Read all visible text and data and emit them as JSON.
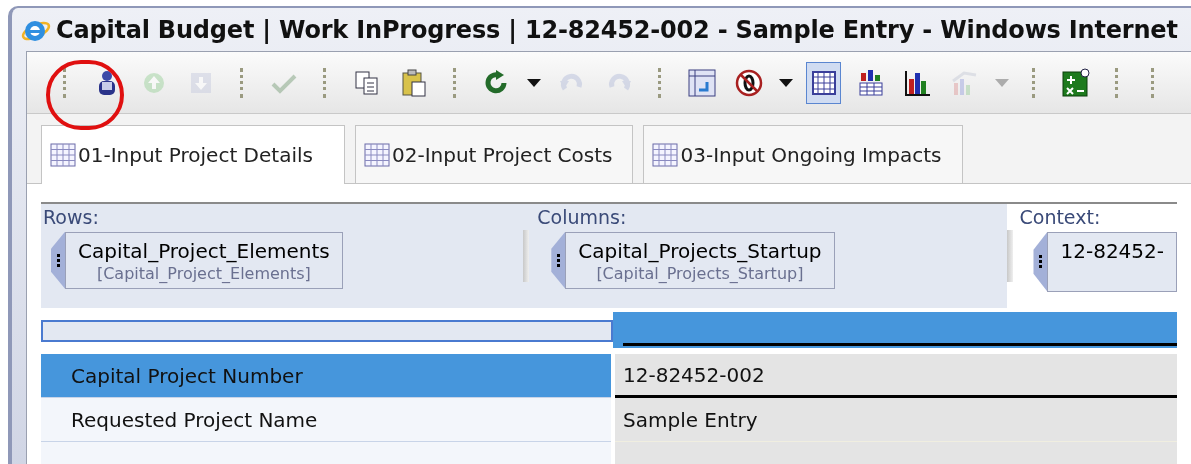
{
  "window": {
    "title": "Capital Budget | Work InProgress | 12-82452-002 - Sample Entry - Windows Internet"
  },
  "toolbar": [
    {
      "kind": "separator"
    },
    {
      "kind": "button",
      "disabled": false,
      "selected": false
    },
    {
      "kind": "button",
      "disabled": true,
      "selected": false
    },
    {
      "kind": "button",
      "disabled": true,
      "selected": false
    },
    {
      "kind": "separator"
    },
    {
      "kind": "button",
      "disabled": true,
      "selected": false
    },
    {
      "kind": "separator"
    },
    {
      "kind": "button",
      "disabled": false,
      "selected": false
    },
    {
      "kind": "button",
      "disabled": false,
      "selected": false
    },
    {
      "kind": "separator"
    },
    {
      "kind": "button",
      "disabled": false,
      "selected": false
    },
    {
      "kind": "caret",
      "disabled": false
    },
    {
      "kind": "button",
      "disabled": true,
      "selected": false
    },
    {
      "kind": "button",
      "disabled": true,
      "selected": false
    },
    {
      "kind": "separator"
    },
    {
      "kind": "button",
      "disabled": false,
      "selected": false
    },
    {
      "kind": "button",
      "disabled": false,
      "selected": false
    },
    {
      "kind": "caret",
      "disabled": false
    },
    {
      "kind": "button",
      "disabled": false,
      "selected": true
    },
    {
      "kind": "button",
      "disabled": false,
      "selected": false
    },
    {
      "kind": "button",
      "disabled": false,
      "selected": false
    },
    {
      "kind": "button",
      "disabled": true,
      "selected": false
    },
    {
      "kind": "caret",
      "disabled": true
    },
    {
      "kind": "separator"
    },
    {
      "kind": "button",
      "disabled": false,
      "selected": false
    },
    {
      "kind": "separator"
    },
    {
      "kind": "separator"
    }
  ],
  "tabs": [
    {
      "label": "01-Input Project Details",
      "selected": true
    },
    {
      "label": "02-Input Project Costs",
      "selected": false
    },
    {
      "label": "03-Input Ongoing Impacts",
      "selected": false
    }
  ],
  "pivot": {
    "rows": {
      "label": "Rows:",
      "dimension": "Capital_Project_Elements",
      "hierarchy": "[Capital_Project_Elements]"
    },
    "columns": {
      "label": "Columns:",
      "dimension": "Capital_Projects_Startup",
      "hierarchy": "[Capital_Projects_Startup]"
    },
    "context": {
      "label": "Context:",
      "value": "12-82452-"
    }
  },
  "table": {
    "rows": [
      {
        "label": "Capital Project Number",
        "value": "12-82452-002",
        "selected": true
      },
      {
        "label": "Requested Project Name",
        "value": "Sample Entry",
        "selected": false
      }
    ]
  }
}
